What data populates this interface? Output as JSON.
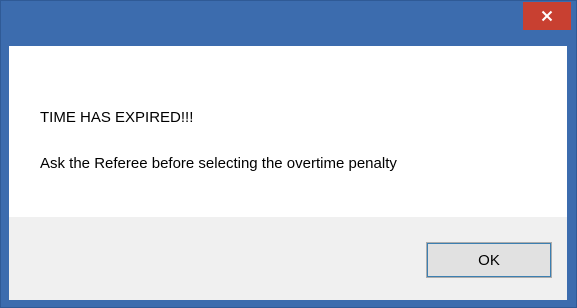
{
  "dialog": {
    "close_icon": "close-icon",
    "message": {
      "line1": "TIME HAS EXPIRED!!!",
      "line2": "Ask the Referee before selecting the overtime penalty"
    },
    "buttons": {
      "ok_label": "OK"
    }
  },
  "colors": {
    "frame": "#3c6cae",
    "close_button": "#c84031",
    "button_bar": "#f0f0f0",
    "button_face": "#e1e1e1",
    "button_focus": "#3c7fb1"
  }
}
